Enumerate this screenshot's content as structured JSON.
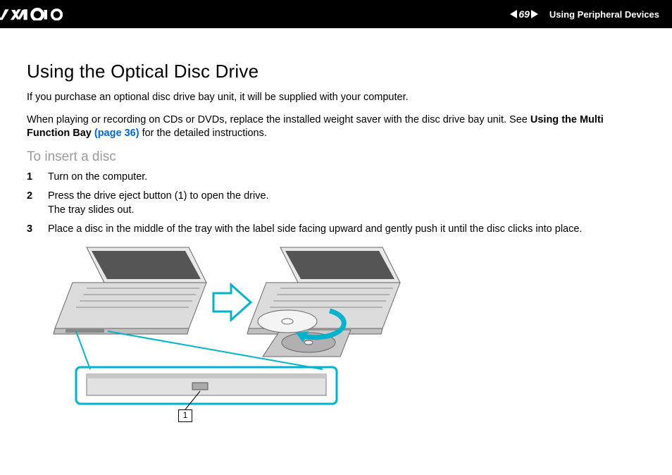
{
  "header": {
    "page_number": "69",
    "section": "Using Peripheral Devices"
  },
  "content": {
    "title": "Using the Optical Disc Drive",
    "para1": "If you purchase an optional disc drive bay unit, it will be supplied with your computer.",
    "para2_a": "When playing or recording on CDs or DVDs, replace the installed weight saver with the disc drive bay unit. See ",
    "para2_bold": "Using the Multi Function Bay ",
    "para2_link": "(page 36)",
    "para2_b": " for the detailed instructions.",
    "subhead": "To insert a disc",
    "steps": [
      "Turn on the computer.",
      "Press the drive eject button (1) to open the drive.\nThe tray slides out.",
      "Place a disc in the middle of the tray with the label side facing upward and gently push it until the disc clicks into place."
    ],
    "callout_label": "1"
  }
}
